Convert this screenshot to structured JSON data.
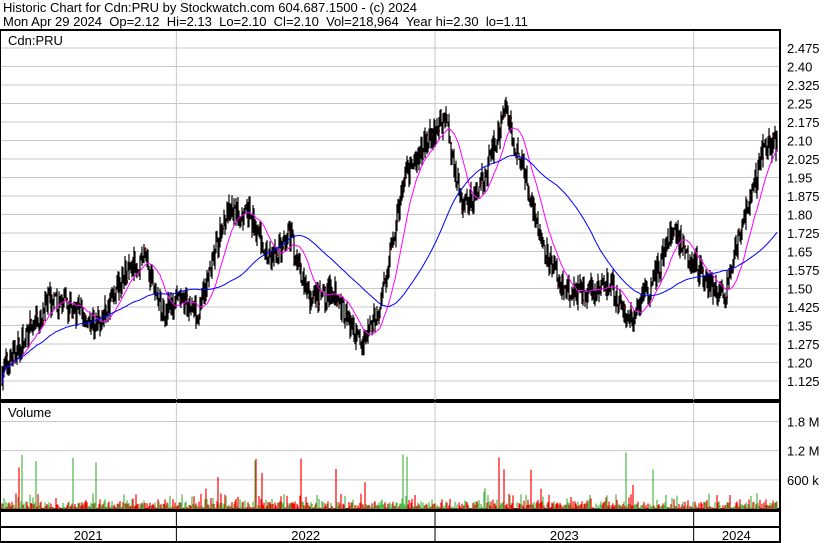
{
  "header": {
    "title": "Historic Chart for Cdn:PRU by Stockwatch.com 604.687.1500 - (c) 2024",
    "quote": "Mon Apr 29 2024  Op=2.12  Hi=2.13  Lo=2.10  Cl=2.10  Vol=218,964  Year hi=2.30  lo=1.11"
  },
  "chart_data": {
    "type": "line",
    "title": "Cdn:PRU",
    "price_panel_label": "Cdn:PRU",
    "volume_panel_label": "Volume",
    "price_ticks": [
      "2.475",
      "2.40",
      "2.325",
      "2.25",
      "2.175",
      "2.10",
      "2.025",
      "1.95",
      "1.875",
      "1.80",
      "1.725",
      "1.65",
      "1.575",
      "1.50",
      "1.425",
      "1.35",
      "1.275",
      "1.20",
      "1.125"
    ],
    "ylim": [
      1.09,
      2.55
    ],
    "volume_ticks": [
      {
        "v": 1800000,
        "label": "1.8 M"
      },
      {
        "v": 1200000,
        "label": "1.2 M"
      },
      {
        "v": 600000,
        "label": "600 k"
      }
    ],
    "volume_max": 2200000,
    "x_years": [
      "2021",
      "2022",
      "2023",
      "2024"
    ],
    "xlim": [
      2021.318,
      2024.33
    ],
    "colors": {
      "bar": "#000000",
      "close": "#ff0000",
      "ma_short": "#ff00ff",
      "ma_long": "#0000ff",
      "vol_up": "#4cb847",
      "vol_down": "#ff0000",
      "vol_flat": "#a0a0a0",
      "grid": "#c8c8c8"
    },
    "moving_averages": [
      21,
      89
    ],
    "close_path": [
      [
        2021.32,
        1.15
      ],
      [
        2021.34,
        1.19
      ],
      [
        2021.41,
        1.29
      ],
      [
        2021.51,
        1.45
      ],
      [
        2021.61,
        1.41
      ],
      [
        2021.7,
        1.35
      ],
      [
        2021.78,
        1.53
      ],
      [
        2021.88,
        1.64
      ],
      [
        2021.94,
        1.41
      ],
      [
        2022.01,
        1.45
      ],
      [
        2022.09,
        1.41
      ],
      [
        2022.19,
        1.8
      ],
      [
        2022.28,
        1.8
      ],
      [
        2022.36,
        1.62
      ],
      [
        2022.44,
        1.7
      ],
      [
        2022.52,
        1.45
      ],
      [
        2022.61,
        1.49
      ],
      [
        2022.71,
        1.27
      ],
      [
        2022.77,
        1.37
      ],
      [
        2022.82,
        1.58
      ],
      [
        2022.88,
        1.94
      ],
      [
        2022.94,
        2.06
      ],
      [
        2023.04,
        2.18
      ],
      [
        2023.11,
        1.82
      ],
      [
        2023.19,
        1.94
      ],
      [
        2023.27,
        2.22
      ],
      [
        2023.33,
        2.02
      ],
      [
        2023.38,
        1.82
      ],
      [
        2023.44,
        1.62
      ],
      [
        2023.5,
        1.48
      ],
      [
        2023.6,
        1.5
      ],
      [
        2023.67,
        1.53
      ],
      [
        2023.75,
        1.37
      ],
      [
        2023.83,
        1.5
      ],
      [
        2023.92,
        1.74
      ],
      [
        2024.02,
        1.58
      ],
      [
        2024.12,
        1.45
      ],
      [
        2024.18,
        1.74
      ],
      [
        2024.22,
        1.86
      ],
      [
        2024.27,
        2.06
      ],
      [
        2024.32,
        2.1
      ]
    ]
  }
}
